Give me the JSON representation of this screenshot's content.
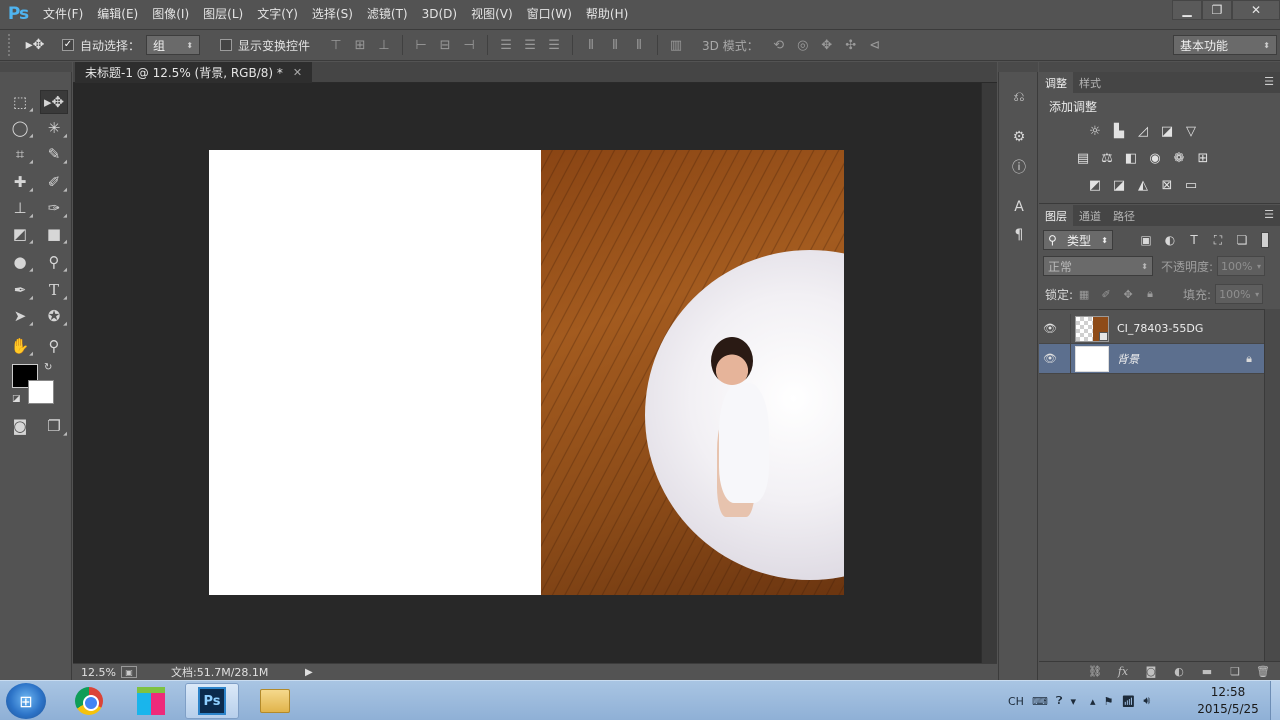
{
  "app": {
    "logo": "Ps"
  },
  "menu": [
    "文件(F)",
    "编辑(E)",
    "图像(I)",
    "图层(L)",
    "文字(Y)",
    "选择(S)",
    "滤镜(T)",
    "3D(D)",
    "视图(V)",
    "窗口(W)",
    "帮助(H)"
  ],
  "options_bar": {
    "auto_select_checked": true,
    "auto_select_label": "自动选择：",
    "auto_select_value": "组",
    "show_transform_checked": false,
    "show_transform_label": "显示变换控件",
    "mode_3d_label": "3D 模式：",
    "workspace": "基本功能"
  },
  "document": {
    "tab_title": "未标题-1 @ 12.5% (背景, RGB/8) *",
    "zoom": "12.5%",
    "doc_info": "文档:51.7M/28.1M"
  },
  "adjustments_panel": {
    "tabs": [
      "调整",
      "样式"
    ],
    "active_tab": "调整",
    "title": "添加调整"
  },
  "layers_panel": {
    "tabs": [
      "图层",
      "通道",
      "路径"
    ],
    "active_tab": "图层",
    "filter_kind": "类型",
    "blend_mode": "正常",
    "opacity_label": "不透明度:",
    "opacity_value": "100%",
    "lock_label": "锁定:",
    "fill_label": "填充:",
    "fill_value": "100%",
    "layers": [
      {
        "name": "CI_78403-55DG",
        "visible": true,
        "selected": false,
        "locked": false,
        "thumbnail": "smart-object"
      },
      {
        "name": "背景",
        "visible": true,
        "selected": true,
        "locked": true,
        "thumbnail": "white"
      }
    ]
  },
  "taskbar": {
    "start_icon": "windows-logo",
    "apps": [
      "chrome",
      "color-app",
      "photoshop",
      "file-explorer"
    ],
    "active_app": "photoshop",
    "ps_label": "Ps",
    "input_lang": "CH",
    "time": "12:58",
    "date": "2015/5/25"
  }
}
